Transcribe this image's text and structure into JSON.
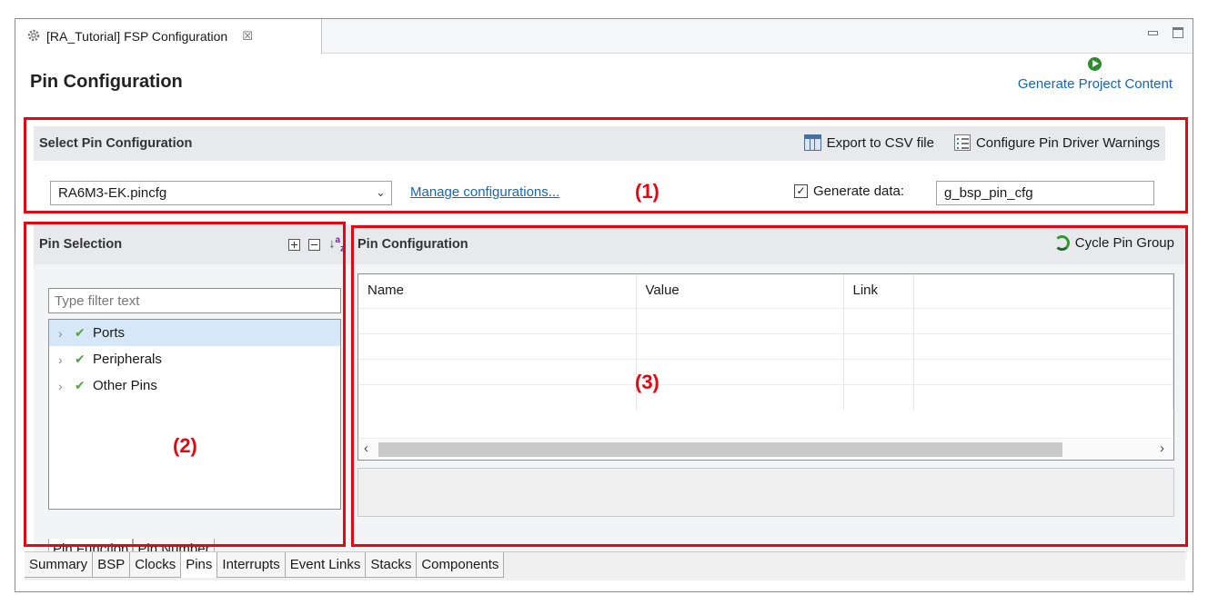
{
  "editor": {
    "tab_title": "[RA_Tutorial] FSP Configuration",
    "close_glyph": "☒"
  },
  "page_title": "Pin Configuration",
  "generate_label": "Generate Project Content",
  "select_config": {
    "header": "Select Pin Configuration",
    "export_label": "Export to CSV file",
    "warnings_label": "Configure Pin Driver Warnings",
    "selected_file": "RA6M3-EK.pincfg",
    "manage_link": "Manage configurations...",
    "generate_data_label": "Generate data:",
    "generate_data_checked": true,
    "generate_data_value": "g_bsp_pin_cfg"
  },
  "pin_selection": {
    "header": "Pin Selection",
    "filter_placeholder": "Type filter text",
    "items": [
      {
        "label": "Ports",
        "selected": true
      },
      {
        "label": "Peripherals",
        "selected": false
      },
      {
        "label": "Other Pins",
        "selected": false
      }
    ],
    "tabs": [
      "Pin Function",
      "Pin Number"
    ]
  },
  "pin_config": {
    "header": "Pin Configuration",
    "cycle_label": "Cycle Pin Group",
    "columns": [
      "Name",
      "Value",
      "Link",
      ""
    ]
  },
  "page_tabs": [
    "Summary",
    "BSP",
    "Clocks",
    "Pins",
    "Interrupts",
    "Event Links",
    "Stacks",
    "Components"
  ],
  "active_page_tab": "Pins",
  "annotations": [
    "(1)",
    "(2)",
    "(3)"
  ],
  "colors": {
    "annotation": "#e30613",
    "link": "#1665b8",
    "check": "#56a345",
    "selection": "#d6e8f7"
  }
}
